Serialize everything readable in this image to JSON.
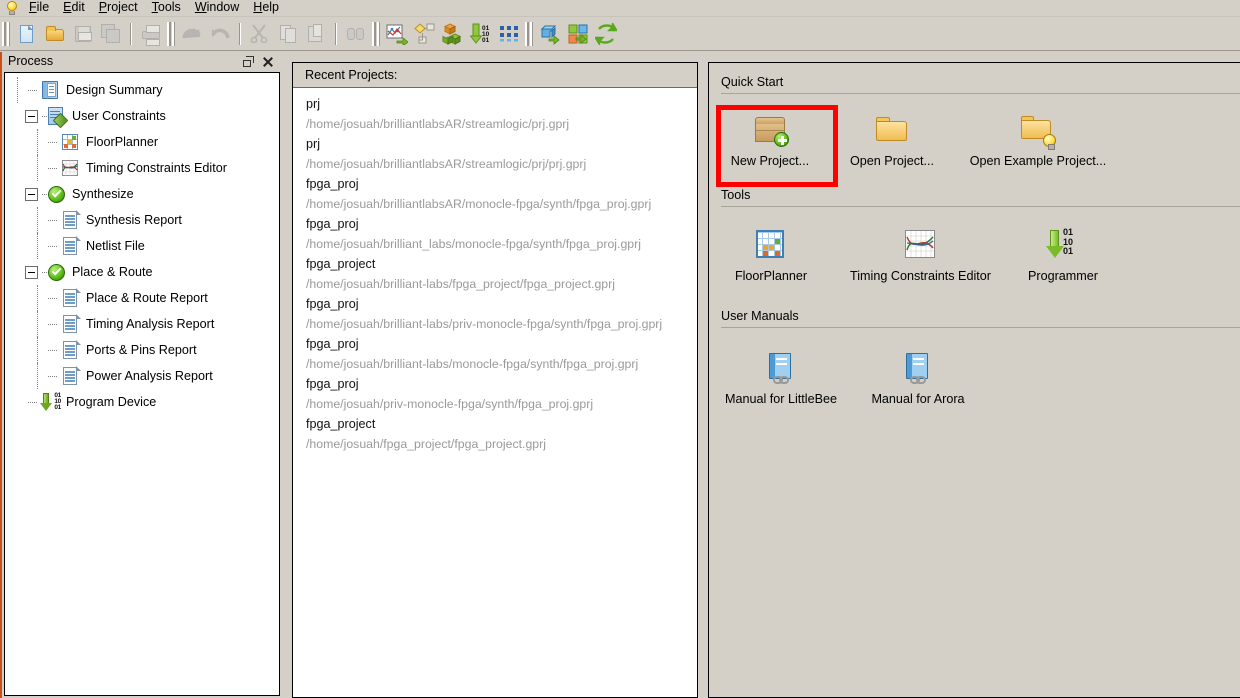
{
  "window": {
    "app_icon": "lightbulb-icon"
  },
  "menubar": {
    "items": [
      {
        "label": "File",
        "mnemonic": "F"
      },
      {
        "label": "Edit",
        "mnemonic": "E"
      },
      {
        "label": "Project",
        "mnemonic": "P"
      },
      {
        "label": "Tools",
        "mnemonic": "T"
      },
      {
        "label": "Window",
        "mnemonic": "W"
      },
      {
        "label": "Help",
        "mnemonic": "H"
      }
    ]
  },
  "toolbar": {
    "groups": [
      {
        "buttons": [
          {
            "name": "new-file-button",
            "icon": "new-file-icon",
            "enabled": true
          },
          {
            "name": "open-file-button",
            "icon": "open-folder-icon",
            "enabled": true
          },
          {
            "name": "save-button",
            "icon": "save-icon",
            "enabled": false
          },
          {
            "name": "save-all-button",
            "icon": "save-all-icon",
            "enabled": false
          },
          {
            "name": "print-button",
            "icon": "print-icon",
            "enabled": false
          }
        ]
      },
      {
        "buttons": [
          {
            "name": "undo-button",
            "icon": "undo-arrow-icon",
            "enabled": false
          },
          {
            "name": "redo-button",
            "icon": "redo-arrow-icon",
            "enabled": false
          },
          {
            "name": "cut-button",
            "icon": "scissors-icon",
            "enabled": false
          },
          {
            "name": "copy-button",
            "icon": "copy-icon",
            "enabled": false
          },
          {
            "name": "paste-button",
            "icon": "paste-icon",
            "enabled": false
          },
          {
            "name": "find-button",
            "icon": "binoculars-icon",
            "enabled": false
          }
        ]
      },
      {
        "buttons": [
          {
            "name": "run-synthesis-button",
            "icon": "synthesis-run-icon",
            "enabled": true
          },
          {
            "name": "flow-diagram-button",
            "icon": "flow-nodes-icon",
            "enabled": true
          },
          {
            "name": "blocks-button",
            "icon": "colored-cubes-icon",
            "enabled": true
          },
          {
            "name": "download-bitstream-button",
            "icon": "download-binary-icon",
            "enabled": true
          },
          {
            "name": "pins-button",
            "icon": "pin-dots-icon",
            "enabled": true
          }
        ]
      },
      {
        "buttons": [
          {
            "name": "add-ip-button",
            "icon": "blue-chip-arrow-icon",
            "enabled": true
          },
          {
            "name": "map-button",
            "icon": "squares-arrow-icon",
            "enabled": true
          },
          {
            "name": "refresh-button",
            "icon": "refresh-arrows-icon",
            "enabled": true
          }
        ]
      }
    ]
  },
  "process_dock": {
    "title": "Process",
    "float_button": "restore-icon",
    "close_button": "close-icon",
    "tree": [
      {
        "label": "Design Summary",
        "icon": "design-summary-icon",
        "level": 1,
        "expander": null
      },
      {
        "label": "User Constraints",
        "icon": "user-constraints-icon",
        "level": 0,
        "expander": "minus"
      },
      {
        "label": "FloorPlanner",
        "icon": "floorplanner-icon",
        "level": 2,
        "expander": null
      },
      {
        "label": "Timing Constraints Editor",
        "icon": "timing-constraints-icon",
        "level": 2,
        "expander": null
      },
      {
        "label": "Synthesize",
        "icon": "status-ok-icon",
        "level": 0,
        "expander": "minus"
      },
      {
        "label": "Synthesis Report",
        "icon": "report-icon",
        "level": 2,
        "expander": null
      },
      {
        "label": "Netlist File",
        "icon": "report-icon",
        "level": 2,
        "expander": null
      },
      {
        "label": "Place & Route",
        "icon": "status-ok-icon",
        "level": 0,
        "expander": "minus"
      },
      {
        "label": "Place & Route Report",
        "icon": "report-icon",
        "level": 2,
        "expander": null
      },
      {
        "label": "Timing Analysis Report",
        "icon": "report-icon",
        "level": 2,
        "expander": null
      },
      {
        "label": "Ports & Pins Report",
        "icon": "report-icon",
        "level": 2,
        "expander": null
      },
      {
        "label": "Power Analysis Report",
        "icon": "report-icon",
        "level": 2,
        "expander": null
      },
      {
        "label": "Program Device",
        "icon": "program-device-icon",
        "level": 1,
        "expander": null
      }
    ]
  },
  "recent_projects": {
    "header": "Recent Projects:",
    "items": [
      {
        "name": "prj",
        "path": "/home/josuah/brilliantlabsAR/streamlogic/prj.gprj"
      },
      {
        "name": "prj",
        "path": "/home/josuah/brilliantlabsAR/streamlogic/prj/prj.gprj"
      },
      {
        "name": "fpga_proj",
        "path": "/home/josuah/brilliantlabsAR/monocle-fpga/synth/fpga_proj.gprj"
      },
      {
        "name": "fpga_proj",
        "path": "/home/josuah/brilliant_labs/monocle-fpga/synth/fpga_proj.gprj"
      },
      {
        "name": "fpga_project",
        "path": "/home/josuah/brilliant-labs/fpga_project/fpga_project.gprj"
      },
      {
        "name": "fpga_proj",
        "path": "/home/josuah/brilliant-labs/priv-monocle-fpga/synth/fpga_proj.gprj"
      },
      {
        "name": "fpga_proj",
        "path": "/home/josuah/brilliant-labs/monocle-fpga/synth/fpga_proj.gprj"
      },
      {
        "name": "fpga_proj",
        "path": "/home/josuah/priv-monocle-fpga/synth/fpga_proj.gprj"
      },
      {
        "name": "fpga_project",
        "path": "/home/josuah/fpga_project/fpga_project.gprj"
      }
    ]
  },
  "quick_start": {
    "sections": [
      {
        "title": "Quick Start",
        "tiles": [
          {
            "label": "New Project...",
            "icon": "new-project-icon",
            "highlighted": true
          },
          {
            "label": "Open Project...",
            "icon": "open-project-icon",
            "highlighted": false
          },
          {
            "label": "Open Example Project...",
            "icon": "open-example-project-icon",
            "highlighted": false
          }
        ]
      },
      {
        "title": "Tools",
        "tiles": [
          {
            "label": "FloorPlanner",
            "icon": "floorplanner-icon",
            "highlighted": false
          },
          {
            "label": "Timing Constraints Editor",
            "icon": "timing-constraints-icon",
            "highlighted": false
          },
          {
            "label": "Programmer",
            "icon": "programmer-icon",
            "highlighted": false
          }
        ]
      },
      {
        "title": "User Manuals",
        "tiles": [
          {
            "label": "Manual for LittleBee",
            "icon": "manual-book-icon",
            "highlighted": false
          },
          {
            "label": "Manual for Arora",
            "icon": "manual-book-icon",
            "highlighted": false
          }
        ]
      }
    ]
  },
  "colors": {
    "window_background": "#d4d0c8",
    "panel_background": "#ffffff",
    "highlight_border": "#fe0000",
    "accent_orange": "#c8511b",
    "path_text": "#9a9a9a",
    "status_ok_green": "#5fc11a"
  }
}
